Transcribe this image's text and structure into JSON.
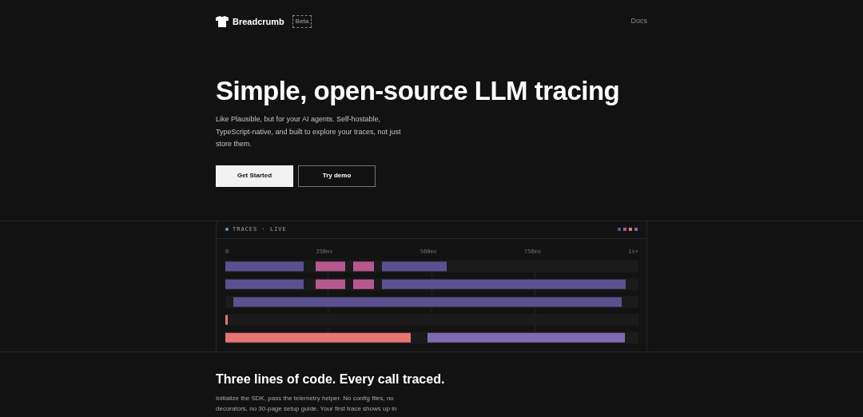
{
  "nav": {
    "brand": "Breadcrumb",
    "badge": "Beta",
    "links": [
      "Docs"
    ]
  },
  "hero": {
    "title": "Simple, open-source LLM tracing",
    "subtitle": "Like Plausible, but for your AI agents. Self-hostable, TypeScript-native, and built to explore your traces, not just store them.",
    "buttons": [
      {
        "label": "Get Started",
        "kind": "primary"
      },
      {
        "label": "Try demo",
        "kind": "secondary"
      }
    ]
  },
  "traces_panel": {
    "title": "TRACES · LIVE",
    "live": true,
    "legend": [
      {
        "color": "#5b5191"
      },
      {
        "color": "#b8578f"
      },
      {
        "color": "#e87473"
      },
      {
        "color": "#7f6bb0"
      }
    ],
    "axis": [
      "0",
      "250ms",
      "500ms",
      "750ms",
      "1s+"
    ]
  },
  "section": {
    "title": "Three lines of code. Every call traced.",
    "text": "Initialize the SDK, pass the telemetry helper. No config files, no decorators, no 30-page setup guide. Your first trace shows up in"
  }
}
